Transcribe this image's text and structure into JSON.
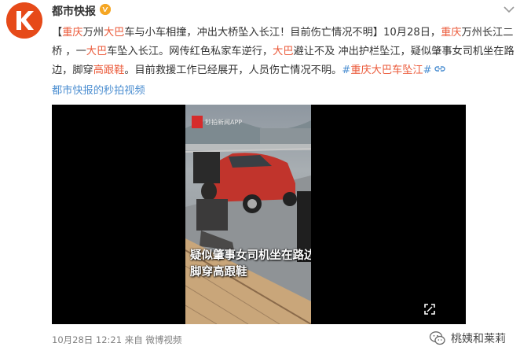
{
  "account": {
    "name": "都市快报",
    "avatar_icon": "k-logo-icon",
    "verified_icon": "verified-v-icon",
    "menu_icon": "chevron-down-icon"
  },
  "post": {
    "segments": [
      {
        "text": "【",
        "style": "normal"
      },
      {
        "text": "重庆",
        "style": "red"
      },
      {
        "text": "万州",
        "style": "normal"
      },
      {
        "text": "大巴",
        "style": "red"
      },
      {
        "text": "车与小车相撞，冲出大桥坠入长江！目前伤亡情况不明】10月28日，",
        "style": "normal"
      },
      {
        "text": "重庆",
        "style": "red"
      },
      {
        "text": "万州长江二桥 ，一",
        "style": "normal"
      },
      {
        "text": "大巴",
        "style": "red"
      },
      {
        "text": "车坠入长江。网传红色私家车逆行，",
        "style": "normal"
      },
      {
        "text": "大巴",
        "style": "red"
      },
      {
        "text": "避让不及 冲出护栏坠江，疑似肇事女司机坐在路边，脚穿",
        "style": "normal"
      },
      {
        "text": "高跟鞋",
        "style": "red"
      },
      {
        "text": "。目前救援工作已经展开，人员伤亡情况不明。",
        "style": "normal"
      },
      {
        "text": "#",
        "style": "blue"
      },
      {
        "text": "重庆大巴车坠江",
        "style": "red"
      },
      {
        "text": "#",
        "style": "blue"
      }
    ],
    "link_icon": "link-icon"
  },
  "video": {
    "link_label": "都市快报的秒拍视频",
    "watermark": "秒拍新闻APP",
    "caption_line1": "疑似肇事女司机坐在路边",
    "caption_line2": "脚穿高跟鞋",
    "fullscreen_icon": "fullscreen-icon"
  },
  "meta": {
    "time": "10月28日 12:21 来自 微博视频"
  },
  "signature": {
    "text": "桃姨和莱莉",
    "icon": "wechat-icon"
  }
}
